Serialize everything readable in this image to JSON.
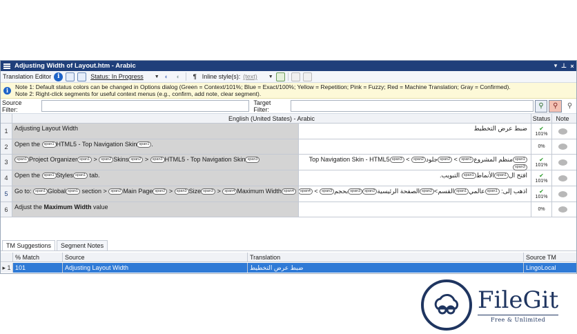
{
  "window": {
    "title": "Adjusting Width of Layout.htm - Arabic",
    "pin_icon": "pin-icon",
    "close_glyph": "×"
  },
  "toolbar": {
    "label": "Translation Editor",
    "status_label": "Status: In Progress",
    "inline_styles_label": "Inline style(s):",
    "inline_styles_value": "(text)"
  },
  "notes": {
    "line1": "Note 1: Default status colors can be changed in Options dialog (Green = Context/101%; Blue = Exact/100%; Yellow = Repetition; Pink = Fuzzy; Red = Machine Translation; Gray = Confirmed).",
    "line2": "Note 2: Right-click segments for useful context menus (e.g., confirm, add note, clear segment)."
  },
  "filters": {
    "source_label": "Source Filter:",
    "target_label": "Target Filter:"
  },
  "grid": {
    "language_header": "English (United States) - Arabic",
    "status_header": "Status",
    "note_header": "Note"
  },
  "segments": [
    {
      "num": "1",
      "target": "ضبط عرض التخطيط",
      "status": "101%"
    },
    {
      "num": "2",
      "target": "",
      "status": "0%"
    },
    {
      "num": "3",
      "status": "101%"
    },
    {
      "num": "4",
      "status": "101%"
    },
    {
      "num": "5",
      "status": "101%"
    },
    {
      "num": "6",
      "target": "",
      "status": "0%"
    }
  ],
  "segment_text": {
    "s1_src": "Adjusting Layout Width",
    "s2_a": "Open the ",
    "s2_b": "HTML5 - Top Navigation Skin",
    "s3_a": "Project Organizer",
    "s3_b": " > ",
    "s3_c": "Skins",
    "s3_d": " > ",
    "s3_e": "HTML5 - Top Navigation Skin",
    "s3_t1": "Top Navigation Skin - HTML5",
    "s3_t2": "منظم المشروع",
    "s3_t3": "جلود",
    "s4_a": "Open the ",
    "s4_b": "Styles",
    "s4_c": " tab.",
    "s4_t1": "افتح ال",
    "s4_t2": "الأنماط",
    "s4_t3": "التبويب.",
    "s5_a": "Go to: ",
    "s5_b": "Global",
    "s5_c": " section > ",
    "s5_d": "Main Page",
    "s5_e": " > ",
    "s5_f": "Size",
    "s5_g": " > ",
    "s5_h": "Maximum Width",
    "s5_t1": "اذهب إلى: ",
    "s5_t2": "عالمي",
    "s5_t3": "القسم>",
    "s5_t4": "الصفحة الرئيسية",
    "s5_t5": "بحجم",
    "s6_a": "Adjust the ",
    "s6_b": "Maximum Width",
    "s6_c": " value"
  },
  "tags": {
    "span1o": "span1",
    "span1c": "span1",
    "span2o": "span2",
    "span2c": "span2",
    "span3o": "span3",
    "span3c": "span3",
    "span4o": "span4",
    "span4c": "span4"
  },
  "bottom_tabs": [
    "TM Suggestions",
    "Segment Notes"
  ],
  "tm": {
    "headers": [
      "% Match",
      "Source",
      "Translation",
      "Source TM"
    ],
    "row": {
      "indicator": "▸ 1",
      "match": "101",
      "source": "Adjusting Layout Width",
      "translation": "ضبط عرض التخطيط",
      "source_tm": "LingoLocal"
    }
  },
  "watermark": {
    "name": "FileGit",
    "tagline": "Free & Unlimited"
  },
  "colors": {
    "titlebar": "#1f3f7a",
    "selection": "#2f7ad6",
    "notes_bg": "#fdf9d8",
    "source_cell": "#d4d4d4",
    "logo": "#1f3560"
  }
}
